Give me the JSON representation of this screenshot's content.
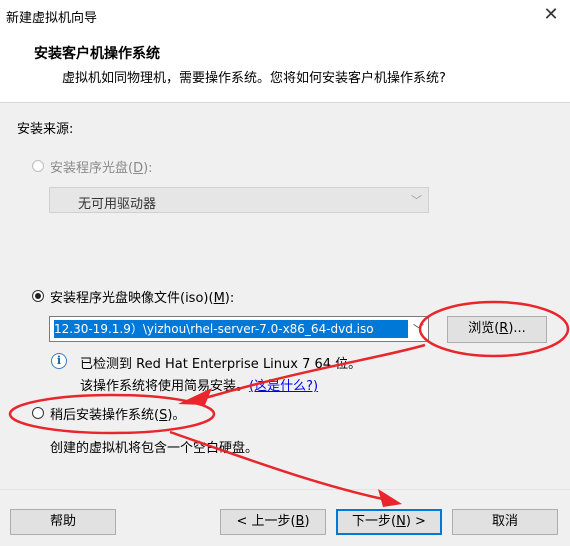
{
  "window": {
    "title": "新建虚拟机向导",
    "close_glyph": "✕"
  },
  "header": {
    "title": "安装客户机操作系统",
    "subtitle": "虚拟机如同物理机，需要操作系统。您将如何安装客户机操作系统?"
  },
  "install_source": {
    "label": "安装来源:",
    "options": [
      {
        "prefix": "安装程序光盘(",
        "hotkey": "D",
        "suffix": "):",
        "selected": false,
        "disabled": true
      },
      {
        "prefix": "安装程序光盘映像文件(iso)(",
        "hotkey": "M",
        "suffix": "):",
        "selected": true,
        "disabled": false
      },
      {
        "prefix": "稍后安装操作系统(",
        "hotkey": "S",
        "suffix": ")。",
        "selected": false,
        "disabled": false
      }
    ],
    "disc_dropdown": {
      "value": "无可用驱动器"
    },
    "iso_path": {
      "value": "12.30-19.1.9）\\yizhou\\rhel-server-7.0-x86_64-dvd.iso"
    },
    "browse_button": {
      "prefix": "浏览(",
      "hotkey": "R",
      "suffix": ")..."
    },
    "detected": {
      "line1": "已检测到 Red Hat Enterprise Linux 7 64 位。",
      "line2": "该操作系统将使用简易安装。",
      "link": "(这是什么?)"
    },
    "later_description": "创建的虚拟机将包含一个空白硬盘。"
  },
  "footer": {
    "help": "帮助",
    "back": {
      "prefix": "< 上一步(",
      "hotkey": "B",
      "suffix": ")"
    },
    "next": {
      "prefix": "下一步(",
      "hotkey": "N",
      "suffix": ") >"
    },
    "cancel": "取消"
  },
  "colors": {
    "annotation_red": "#e8262b",
    "selection_blue": "#0078d7",
    "panel_bg": "#f0f0f0"
  }
}
